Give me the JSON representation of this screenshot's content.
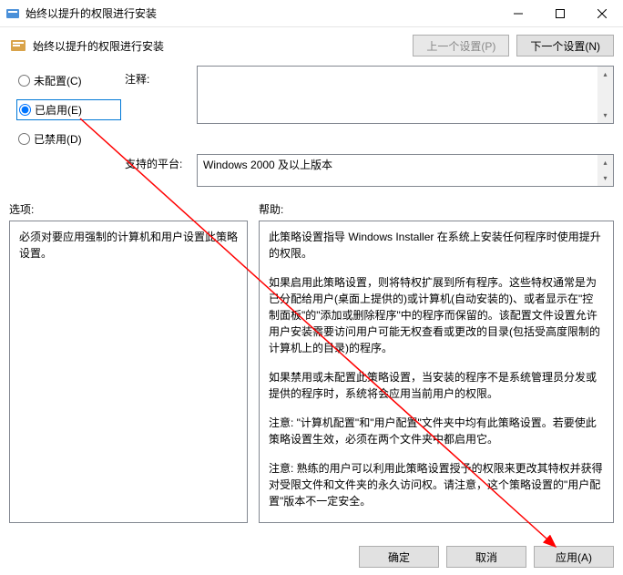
{
  "window": {
    "title": "始终以提升的权限进行安装"
  },
  "header": {
    "title": "始终以提升的权限进行安装",
    "prev_btn": "上一个设置(P)",
    "next_btn": "下一个设置(N)"
  },
  "radios": {
    "not_configured": "未配置(C)",
    "enabled": "已启用(E)",
    "disabled": "已禁用(D)",
    "selected": "enabled"
  },
  "labels": {
    "notes": "注释:",
    "platform": "支持的平台:",
    "options": "选项:",
    "help": "帮助:"
  },
  "notes_text": "",
  "platform_text": "Windows 2000 及以上版本",
  "options_text": "必须对要应用强制的计算机和用户设置此策略设置。",
  "help_paragraphs": [
    "此策略设置指导 Windows Installer 在系统上安装任何程序时使用提升的权限。",
    "如果启用此策略设置，则将特权扩展到所有程序。这些特权通常是为已分配给用户(桌面上提供的)或计算机(自动安装的)、或者显示在\"控制面板\"的\"添加或删除程序\"中的程序而保留的。该配置文件设置允许用户安装需要访问用户可能无权查看或更改的目录(包括受高度限制的计算机上的目录)的程序。",
    "如果禁用或未配置此策略设置，当安装的程序不是系统管理员分发或提供的程序时，系统将会应用当前用户的权限。",
    "注意: \"计算机配置\"和\"用户配置\"文件夹中均有此策略设置。若要使此策略设置生效，必须在两个文件夹中都启用它。",
    "注意: 熟练的用户可以利用此策略设置授予的权限来更改其特权并获得对受限文件和文件夹的永久访问权。请注意，这个策略设置的\"用户配置\"版本不一定安全。"
  ],
  "footer": {
    "ok": "确定",
    "cancel": "取消",
    "apply": "应用(A)"
  }
}
